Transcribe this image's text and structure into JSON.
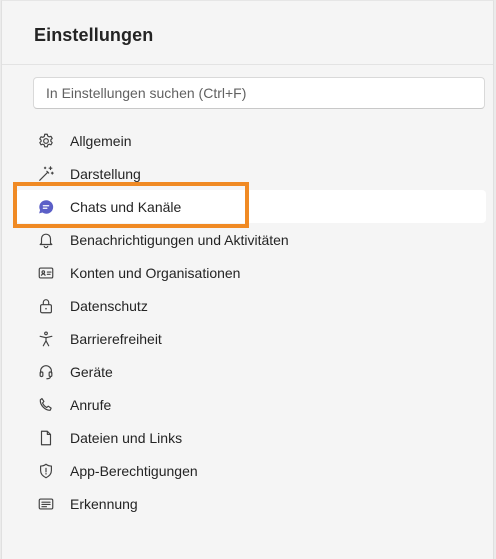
{
  "header": {
    "title": "Einstellungen"
  },
  "search": {
    "placeholder": "In Einstellungen suchen (Ctrl+F)"
  },
  "accent_color": "#5b5fc7",
  "highlight_color": "#f08a24",
  "nav": {
    "selected": "Chats und Kanäle",
    "items": [
      {
        "label": "Allgemein",
        "icon": "gear-icon"
      },
      {
        "label": "Darstellung",
        "icon": "magic-wand-icon"
      },
      {
        "label": "Chats und Kanäle",
        "icon": "chat-icon"
      },
      {
        "label": "Benachrichtigungen und Aktivitäten",
        "icon": "bell-icon"
      },
      {
        "label": "Konten und Organisationen",
        "icon": "contact-card-icon"
      },
      {
        "label": "Datenschutz",
        "icon": "lock-icon"
      },
      {
        "label": "Barrierefreiheit",
        "icon": "accessibility-icon"
      },
      {
        "label": "Geräte",
        "icon": "headset-icon"
      },
      {
        "label": "Anrufe",
        "icon": "phone-icon"
      },
      {
        "label": "Dateien und Links",
        "icon": "document-icon"
      },
      {
        "label": "App-Berechtigungen",
        "icon": "shield-icon"
      },
      {
        "label": "Erkennung",
        "icon": "card-text-icon"
      }
    ]
  }
}
